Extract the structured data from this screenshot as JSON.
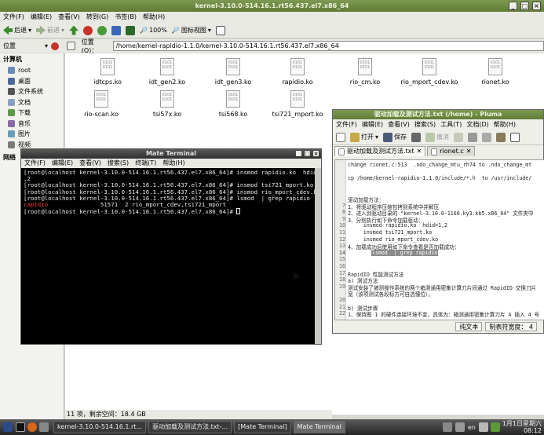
{
  "file_manager": {
    "title": "kernel-3.10.0-514.16.1.rt56.437.el7.x86_64",
    "menu": [
      "文件(F)",
      "编辑(E)",
      "查看(V)",
      "转到(G)",
      "书签(B)",
      "帮助(H)"
    ],
    "toolbar": {
      "back": "后退",
      "forward": "前进",
      "zoom": "100%",
      "view_mode": "图标视图"
    },
    "location_label": "位置(O)：",
    "location_path": "/home/kernel-rapidio-1.1.0/kernel-3.10.0-514.16.1.rt56.437.el7.x86_64",
    "side_pane_label": "位置",
    "sidebar": {
      "computer_header": "计算机",
      "items": [
        "root",
        "桌面",
        "文件系统",
        "文档",
        "下载",
        "音乐",
        "图片",
        "视频"
      ],
      "network_header": "网络"
    },
    "files": [
      "idtcps.ko",
      "idt_gen2.ko",
      "idt_gen3.ko",
      "rapidio.ko",
      "rio_cm.ko",
      "rio_mport_cdev.ko",
      "rionet.ko",
      "rio-scan.ko",
      "tsi57x.ko",
      "tsi568.ko",
      "tsi721_mport.ko"
    ],
    "status": "11 项，剩余空间：18.4 GB"
  },
  "terminal": {
    "title": "Mate Terminal",
    "menu": [
      "文件(F)",
      "编辑(E)",
      "查看(V)",
      "搜索(S)",
      "终端(T)",
      "帮助(H)"
    ],
    "lines": [
      "[root@localhost kernel-3.10.0-514.16.1.rt56.437.el7.x86_64]# insmod rapidio.ko  hdid=1",
      ",2",
      "[root@localhost kernel-3.10.0-514.16.1.rt56.437.el7.x86_64]# insmod tsi721_mport.ko",
      "[root@localhost kernel-3.10.0-514.16.1.rt56.437.el7.x86_64]# insmod rio_mport_cdev.ko",
      "[root@localhost kernel-3.10.0-514.16.1.rt56.437.el7.x86_64]# lsmod  | grep rapidio"
    ],
    "lsmod_red": "rapidio",
    "lsmod_rest": "               51571  2 rio_mport_cdev,tsi721_mport",
    "prompt": "[root@localhost kernel-3.10.0-514.16.1.rt56.437.el7.x86_64]# "
  },
  "pluma": {
    "title": "驱动加载及测试方法.txt (/home) - Pluma",
    "menu": [
      "文件(F)",
      "编辑(E)",
      "查看(V)",
      "搜索(S)",
      "工具(T)",
      "文档(D)",
      "帮助(H)"
    ],
    "toolbar": {
      "open": "打开",
      "save": "保存",
      "undo": "撤消"
    },
    "tabs": [
      "驱动加载及测试方法.txt",
      "rionet.c"
    ],
    "lines": [
      {
        "n": "",
        "t": "change rionet.c:513  .ndo_change_mtu_rh74 to .ndo_change_mt"
      },
      {
        "n": "",
        "t": ""
      },
      {
        "n": "",
        "t": "cp /home/kernel-rapidio-1.1.0/include/*.h  to /usr/include/"
      },
      {
        "n": "",
        "t": ""
      },
      {
        "n": "",
        "t": ""
      },
      {
        "n": "",
        "t": "驱动加载方法："
      },
      {
        "n": "7",
        "t": "1、将驱动程序压缩包拷到系统中并解压"
      },
      {
        "n": "8",
        "t": "2、进入到驱动目录的 \"kernel-3.10.0-1160.ky3.kb5.x86_64\" 文件夹中"
      },
      {
        "n": "9",
        "t": "3、分别执行如下命令加载驱动："
      },
      {
        "n": "10",
        "t": "     insmod rapidio.ko  hdid=1,2"
      },
      {
        "n": "11",
        "t": "     insmod tsi721_mport.ko"
      },
      {
        "n": "12",
        "t": "     insmod rio_mport_cdev.ko"
      },
      {
        "n": "13",
        "t": "4、加载成功后使用如下命令查看是否加载成功："
      },
      {
        "n": "14",
        "t": "     lsmod  | grep rapidio"
      },
      {
        "n": "15",
        "t": ""
      },
      {
        "n": "16",
        "t": ""
      },
      {
        "n": "17",
        "t": "RapidIO 性能测试方法"
      },
      {
        "n": "18",
        "t": "a) 测试方法"
      },
      {
        "n": "19",
        "t": "测试安装了被测操作系统的两个箱测通用密集计算刀片间通过 RapidIO 交换刀片"
      },
      {
        "n": "",
        "t": "宽（该项测试各段标方可自选懂位）。"
      },
      {
        "n": "20",
        "t": ""
      },
      {
        "n": "21",
        "t": "b) 测试步骤"
      },
      {
        "n": "22",
        "t": "1、保持图 1 的硬件连接环境不变，具体为：箱测通用密集计算刀片 A 插入 4 号"
      }
    ],
    "status": {
      "format": "纯文本",
      "tab_width": "制表符宽度： 4"
    }
  },
  "taskbar": {
    "tasks": [
      "kernel-3.10.0-514.16.1.rt...",
      "驱动加载及测试方法.txt-...",
      "[Mate Terminal]",
      "Mate Terminal"
    ],
    "lang": "en",
    "date": "1月1日星期六",
    "time": "08:12"
  }
}
